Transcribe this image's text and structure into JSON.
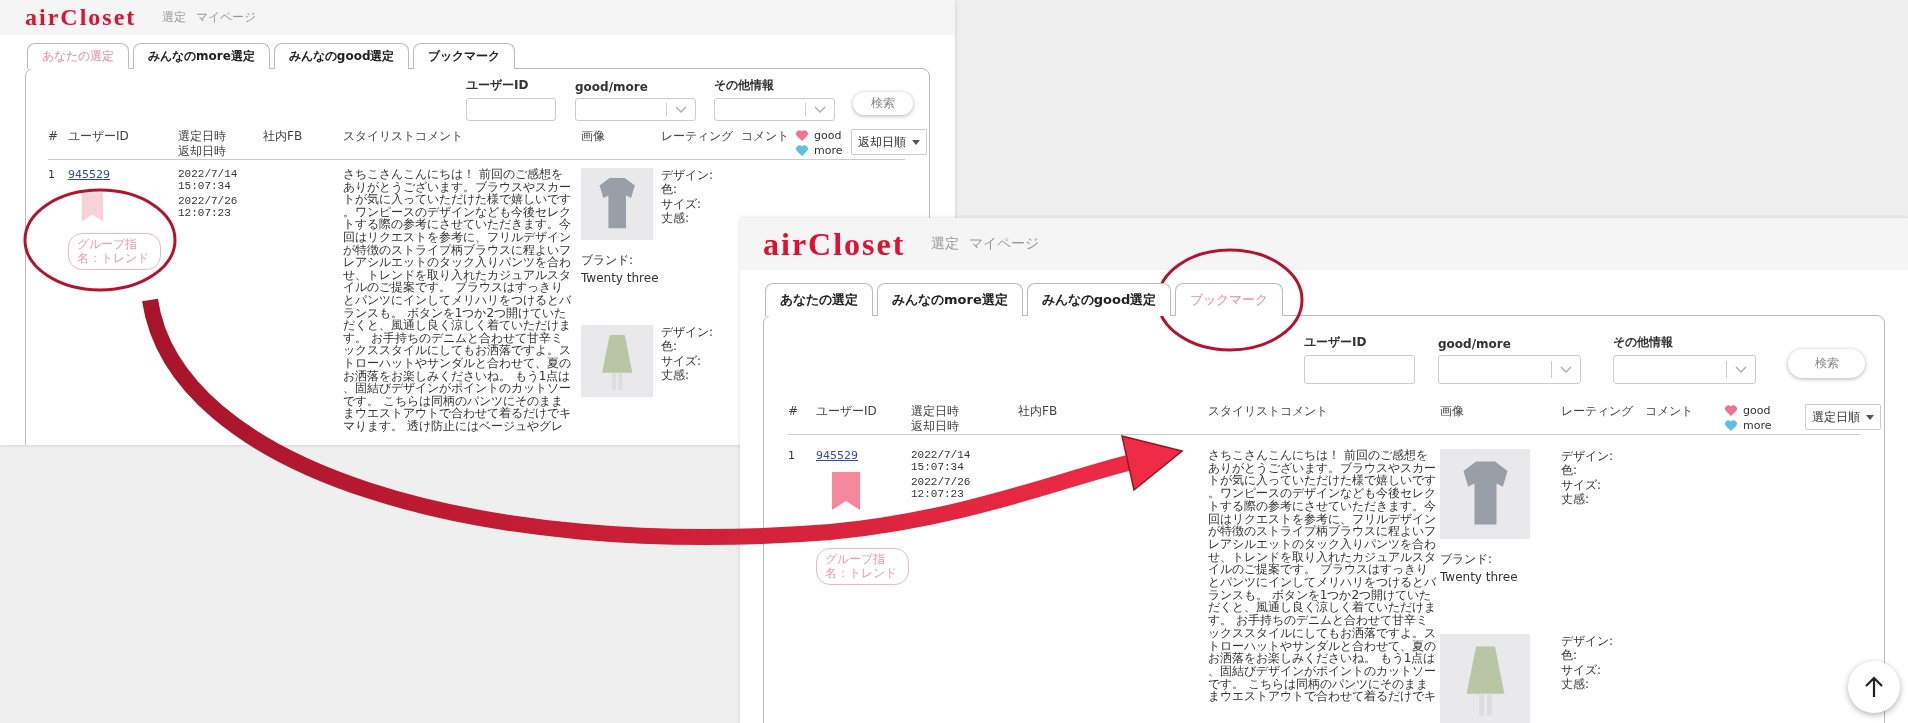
{
  "screens": [
    {
      "logo": "airCloset",
      "nav": [
        "選定",
        "マイページ"
      ],
      "tabs": [
        {
          "label": "あなたの選定",
          "selected": true
        },
        {
          "label": "みんなのmore選定",
          "selected": false
        },
        {
          "label": "みんなのgood選定",
          "selected": false
        },
        {
          "label": "ブックマーク",
          "selected": false
        }
      ],
      "filters": [
        {
          "kind": "text",
          "label": "ユーザーID"
        },
        {
          "kind": "select",
          "label": "good/more"
        },
        {
          "kind": "select",
          "label": "その他情報"
        }
      ],
      "search_button": "検索",
      "columns": [
        "#",
        "ユーザーID",
        "選定日時返却日時",
        "社内FB",
        "スタイリストコメント",
        "画像",
        "レーティング",
        "コメント"
      ],
      "legend": [
        {
          "label": "good",
          "color": "#f4728f"
        },
        {
          "label": "more",
          "color": "#5bbfe6"
        }
      ],
      "sort": "返却日順",
      "rows": [
        {
          "number": "1",
          "user_id": "945529",
          "selected_at": "2022/7/14 15:07:34",
          "returned_at": "2022/7/26 12:07:23",
          "bookmarked": false,
          "tag": "グループ指名：トレンド",
          "comment": "さちこさんこんにちは！ 前回のご感想をありがとうございます。ブラウスやスカートが気に入っていただけた様で嬉しいです。ワンピースのデザインなども今後セレクトする際の参考にさせていただきます。今回はリクエストを参考に、フリルデザインが特徴のストライプ柄ブラウスに程よいフレアシルエットのタック入りパンツを合わせ、トレンドを取り入れたカジュアルスタイルのご提案です。 ブラウスはすっきりとパンツにインしてメリハリをつけるとバランスも。 ボタンを1つか2つ開けていただくと、風通し良く涼しく着ていただけます。 お手持ちのデニムと合わせて甘辛ミックススタイルにしてもお洒落ですよ。ストローハットやサンダルと合わせて、夏のお洒落をお楽しみくださいね。 もう1点は、固結びデザインがポイントのカットソーです。 こちらは同柄のパンツにそのまままウエストアウトで合わせて着るだけでキマります。 透け防止にはベージュやグレ",
          "items": [
            {
              "kind": "blouse",
              "specs": [
                "デザイン:",
                "色:",
                "サイズ:",
                "丈感:"
              ],
              "brand_label": "ブランド:",
              "brand": "Twenty three"
            },
            {
              "kind": "skirt",
              "specs": [
                "デザイン:",
                "色:",
                "サイズ:",
                "丈感:"
              ]
            }
          ]
        }
      ]
    },
    {
      "logo": "airCloset",
      "nav": [
        "選定",
        "マイページ"
      ],
      "tabs": [
        {
          "label": "あなたの選定",
          "selected": false
        },
        {
          "label": "みんなのmore選定",
          "selected": false
        },
        {
          "label": "みんなのgood選定",
          "selected": false
        },
        {
          "label": "ブックマーク",
          "selected": true
        }
      ],
      "filters": [
        {
          "kind": "text",
          "label": "ユーザーID"
        },
        {
          "kind": "select",
          "label": "good/more"
        },
        {
          "kind": "select",
          "label": "その他情報"
        }
      ],
      "search_button": "検索",
      "columns": [
        "#",
        "ユーザーID",
        "選定日時返却日時",
        "社内FB",
        "スタイリストコメント",
        "画像",
        "レーティング",
        "コメント"
      ],
      "legend": [
        {
          "label": "good",
          "color": "#f4728f"
        },
        {
          "label": "more",
          "color": "#5bbfe6"
        }
      ],
      "sort": "選定日順",
      "rows": [
        {
          "number": "1",
          "user_id": "945529",
          "selected_at": "2022/7/14 15:07:34",
          "returned_at": "2022/7/26 12:07:23",
          "bookmarked": true,
          "tag": "グループ指名：トレンド",
          "comment": "さちこさんこんにちは！ 前回のご感想をありがとうございます。ブラウスやスカートが気に入っていただけた様で嬉しいです。ワンピースのデザインなども今後セレクトする際の参考にさせていただきます。今回はリクエストを参考に、フリルデザインが特徴のストライプ柄ブラウスに程よいフレアシルエットのタック入りパンツを合わせ、トレンドを取り入れたカジュアルスタイルのご提案です。 ブラウスはすっきりとパンツにインしてメリハリをつけるとバランスも。 ボタンを1つか2つ開けていただくと、風通し良く涼しく着ていただけます。 お手持ちのデニムと合わせて甘辛ミックススタイルにしてもお洒落ですよ。ストローハットやサンダルと合わせて、夏のお洒落をお楽しみくださいね。 もう1点は、固結びデザインがポイントのカットソーです。 こちらは同柄のパンツにそのまままウエストアウトで合わせて着るだけでキ",
          "items": [
            {
              "kind": "blouse",
              "specs": [
                "デザイン:",
                "色:",
                "サイズ:",
                "丈感:"
              ],
              "brand_label": "ブランド:",
              "brand": "Twenty three"
            },
            {
              "kind": "skirt",
              "specs": [
                "デザイン:",
                "色:",
                "サイズ:",
                "丈感:"
              ]
            }
          ]
        }
      ],
      "back_to_top": true
    }
  ]
}
